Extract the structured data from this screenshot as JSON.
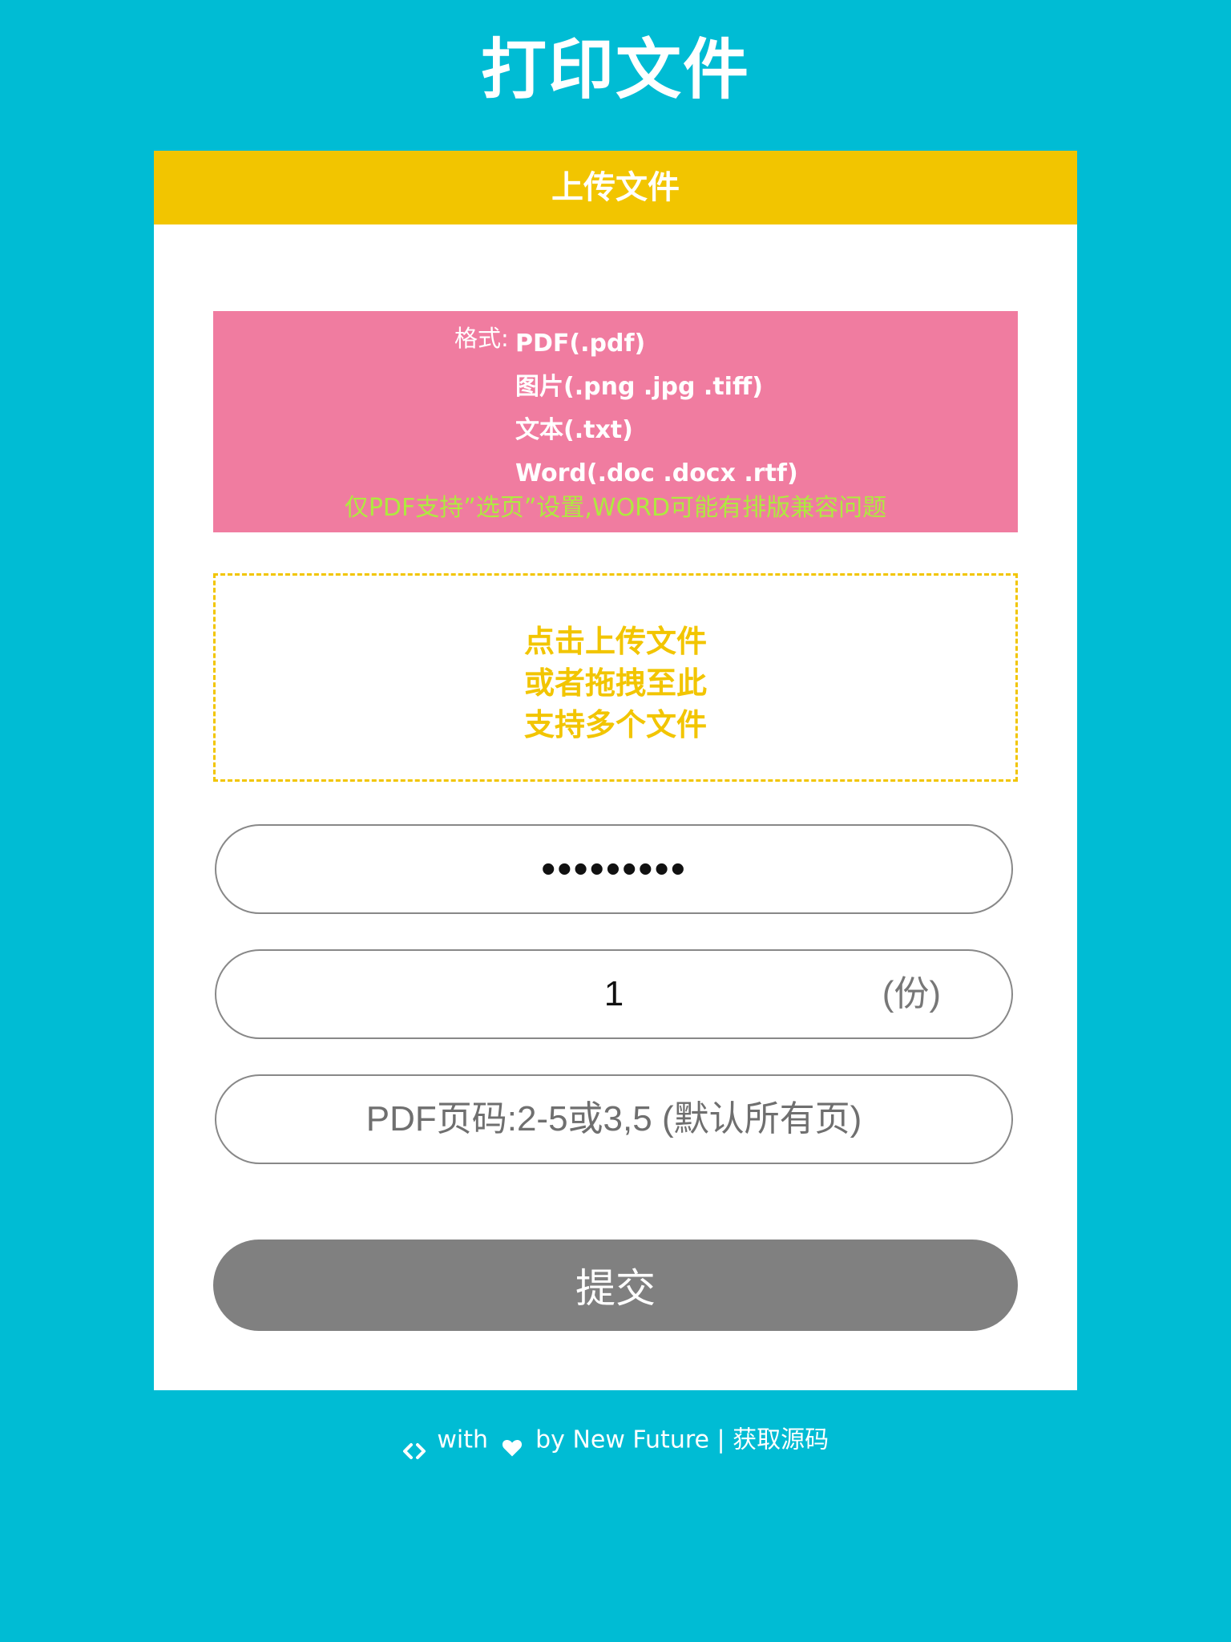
{
  "header": {
    "title": "打印文件"
  },
  "card": {
    "title": "上传文件",
    "formats": {
      "label": "格式:",
      "items": [
        "PDF(.pdf)",
        "图片(.png .jpg .tiff)",
        "文本(.txt)",
        "Word(.doc .docx .rtf)"
      ],
      "note": "仅PDF支持”选页”设置,WORD可能有排版兼容问题"
    },
    "upload": {
      "lines": [
        "点击上传文件",
        "或者拖拽至此",
        "支持多个文件"
      ]
    },
    "password_value": "123456789",
    "copies": {
      "value": "1",
      "unit": "(份)"
    },
    "pages": {
      "placeholder": "PDF页码:2-5或3,5 (默认所有页)"
    },
    "submit_label": "提交"
  },
  "footer": {
    "with_text": "with",
    "by_text": "by New Future",
    "separator": "|",
    "source_link": "获取源码",
    "icons": [
      "code-icon",
      "heart-icon"
    ]
  },
  "colors": {
    "background": "#00bcd4",
    "header_accent": "#f2c500",
    "format_box": "#f07ca0",
    "note_green": "#aeea3f",
    "submit_gray": "#808080"
  }
}
